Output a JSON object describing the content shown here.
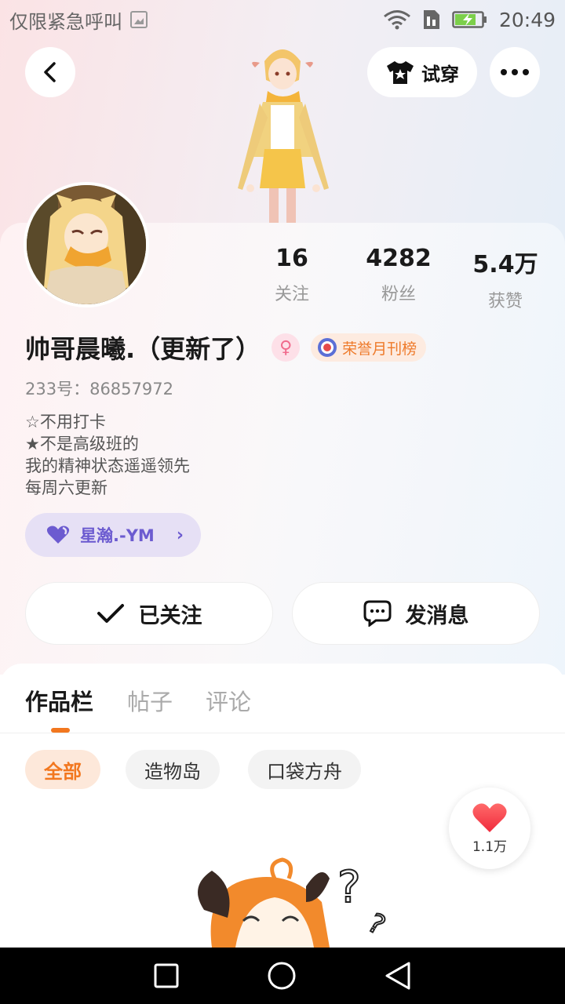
{
  "status_bar": {
    "carrier": "仅限紧急呼叫",
    "time": "20:49"
  },
  "header": {
    "tryon_label": "试穿"
  },
  "profile": {
    "name": "帅哥晨曦.（更新了）",
    "gender": "female",
    "honor_badge": "荣誉月刊榜",
    "user_id": "233号：86857972",
    "bio": [
      "☆不用打卡",
      "★不是高级班的",
      "我的精神状态遥遥领先",
      "每周六更新"
    ],
    "cp_name": "星瀚.-YM"
  },
  "stats": [
    {
      "value": "16",
      "label": "关注"
    },
    {
      "value": "4282",
      "label": "粉丝"
    },
    {
      "value": "5.4万",
      "label": "获赞"
    }
  ],
  "actions": {
    "follow_label": "已关注",
    "message_label": "发消息"
  },
  "tabs": [
    {
      "label": "作品栏",
      "active": true
    },
    {
      "label": "帖子",
      "active": false
    },
    {
      "label": "评论",
      "active": false
    }
  ],
  "filters": [
    {
      "label": "全部",
      "active": true
    },
    {
      "label": "造物岛",
      "active": false
    },
    {
      "label": "口袋方舟",
      "active": false
    }
  ],
  "like_button": {
    "count": "1.1万"
  },
  "icons": {
    "back": "chevron-left-icon",
    "tryon": "tshirt-icon",
    "more": "more-dots-icon",
    "follow": "check-icon",
    "message": "chat-bubble-icon",
    "cp": "heart-icon",
    "like": "heart-icon"
  },
  "colors": {
    "accent": "#f2771f",
    "cp_purple": "#6c5bd0",
    "like_red": "#f43a48"
  }
}
